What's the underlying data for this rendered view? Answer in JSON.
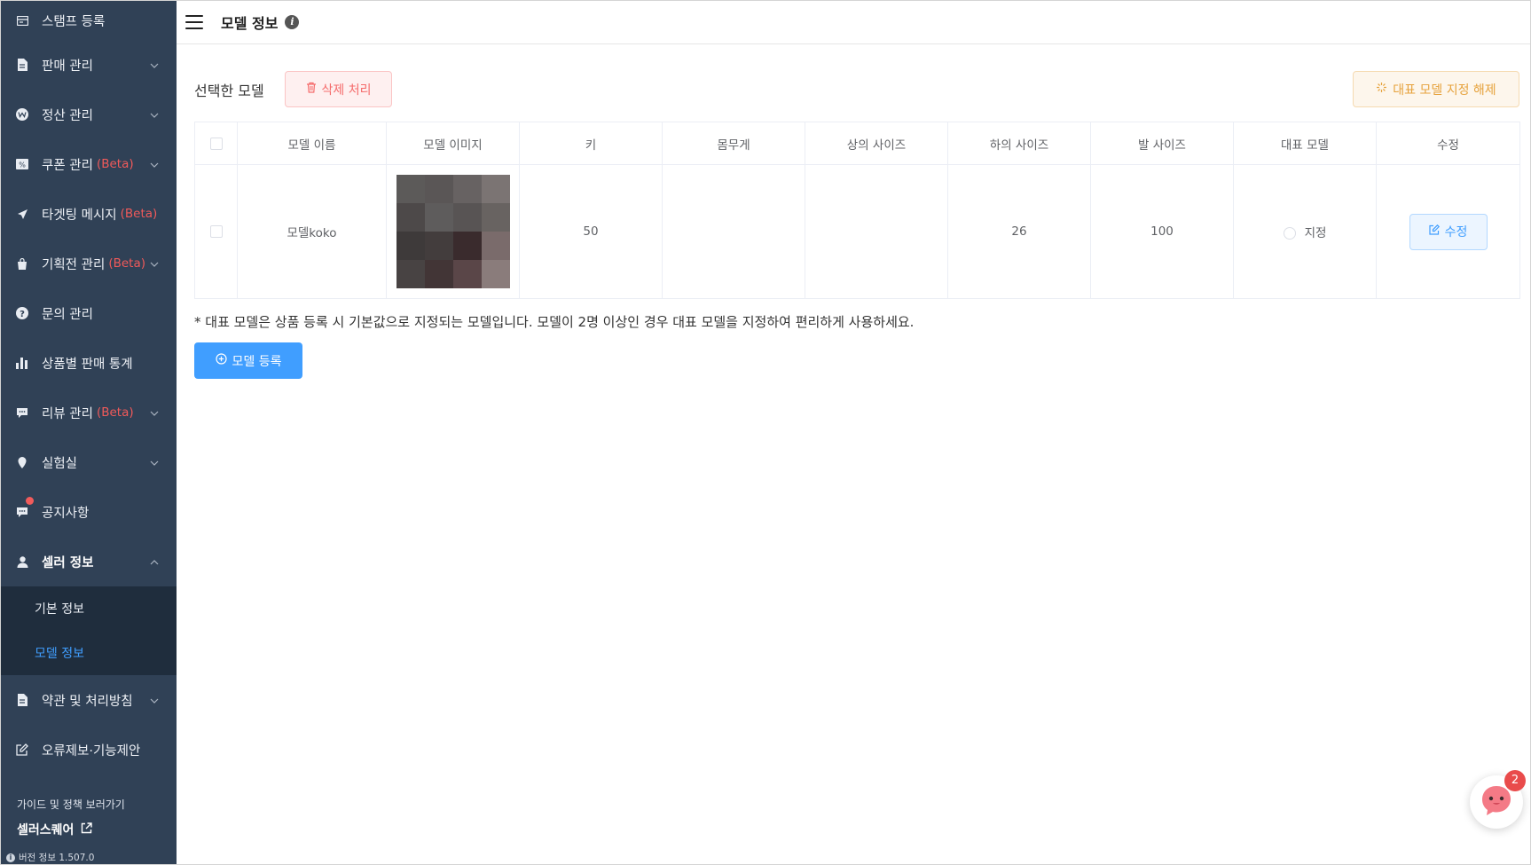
{
  "sidebar": {
    "items": [
      {
        "label": "스탬프 등록",
        "beta": "",
        "icon": "ticket-icon",
        "chevron": false
      },
      {
        "label": "판매 관리",
        "beta": "",
        "icon": "document-icon",
        "chevron": true
      },
      {
        "label": "정산 관리",
        "beta": "",
        "icon": "won-icon",
        "chevron": true
      },
      {
        "label": "쿠폰 관리",
        "beta": "(Beta)",
        "icon": "coupon-icon",
        "chevron": true
      },
      {
        "label": "타겟팅 메시지",
        "beta": "(Beta)",
        "icon": "send-icon",
        "chevron": false
      },
      {
        "label": "기획전 관리",
        "beta": "(Beta)",
        "icon": "bag-icon",
        "chevron": true
      },
      {
        "label": "문의 관리",
        "beta": "",
        "icon": "question-icon",
        "chevron": false
      },
      {
        "label": "상품별 판매 통계",
        "beta": "",
        "icon": "bar-chart-icon",
        "chevron": false
      },
      {
        "label": "리뷰 관리",
        "beta": "(Beta)",
        "icon": "comment-icon",
        "chevron": true
      },
      {
        "label": "실험실",
        "beta": "",
        "icon": "pin-icon",
        "chevron": true
      },
      {
        "label": "공지사항",
        "beta": "",
        "icon": "chat-icon",
        "chevron": false
      },
      {
        "label": "셀러 정보",
        "beta": "",
        "icon": "user-icon",
        "chevron": true
      }
    ],
    "sub_items": [
      {
        "label": "기본 정보"
      },
      {
        "label": "모델 정보"
      }
    ],
    "after_items": [
      {
        "label": "약관 및 처리방침",
        "icon": "file-icon",
        "chevron": true
      },
      {
        "label": "오류제보·기능제안",
        "icon": "edit-icon",
        "chevron": false
      }
    ],
    "guide_text": "가이드 및 정책 보러가기",
    "brand": "셀러스퀘어",
    "version": "버전 정보 1.507.0"
  },
  "header": {
    "title": "모델 정보"
  },
  "main": {
    "selected_label": "선택한 모델",
    "delete_label": "삭제 처리",
    "unset_label": "대표 모델 지정 해제",
    "columns": [
      "모델 이름",
      "모델 이미지",
      "키",
      "몸무게",
      "상의 사이즈",
      "하의 사이즈",
      "발 사이즈",
      "대표 모델",
      "수정"
    ],
    "rows": [
      {
        "name": "모델koko",
        "height": "50",
        "weight": "",
        "top_size": "",
        "bottom_size": "26",
        "shoe_size": "100",
        "representative_label": "지정",
        "edit_label": "수정"
      }
    ],
    "note": "* 대표 모델은 상품 등록 시 기본값으로 지정되는 모델입니다. 모델이 2명 이상인 경우 대표 모델을 지정하여 편리하게 사용하세요.",
    "register_label": "모델 등록"
  },
  "chat": {
    "badge_count": "2"
  },
  "colors": {
    "sidebar_bg": "#304156",
    "submenu_bg": "#1f2d3d",
    "primary": "#409eff",
    "danger": "#f56c6c",
    "warning": "#e6a23c",
    "beta": "#f05a5a"
  }
}
